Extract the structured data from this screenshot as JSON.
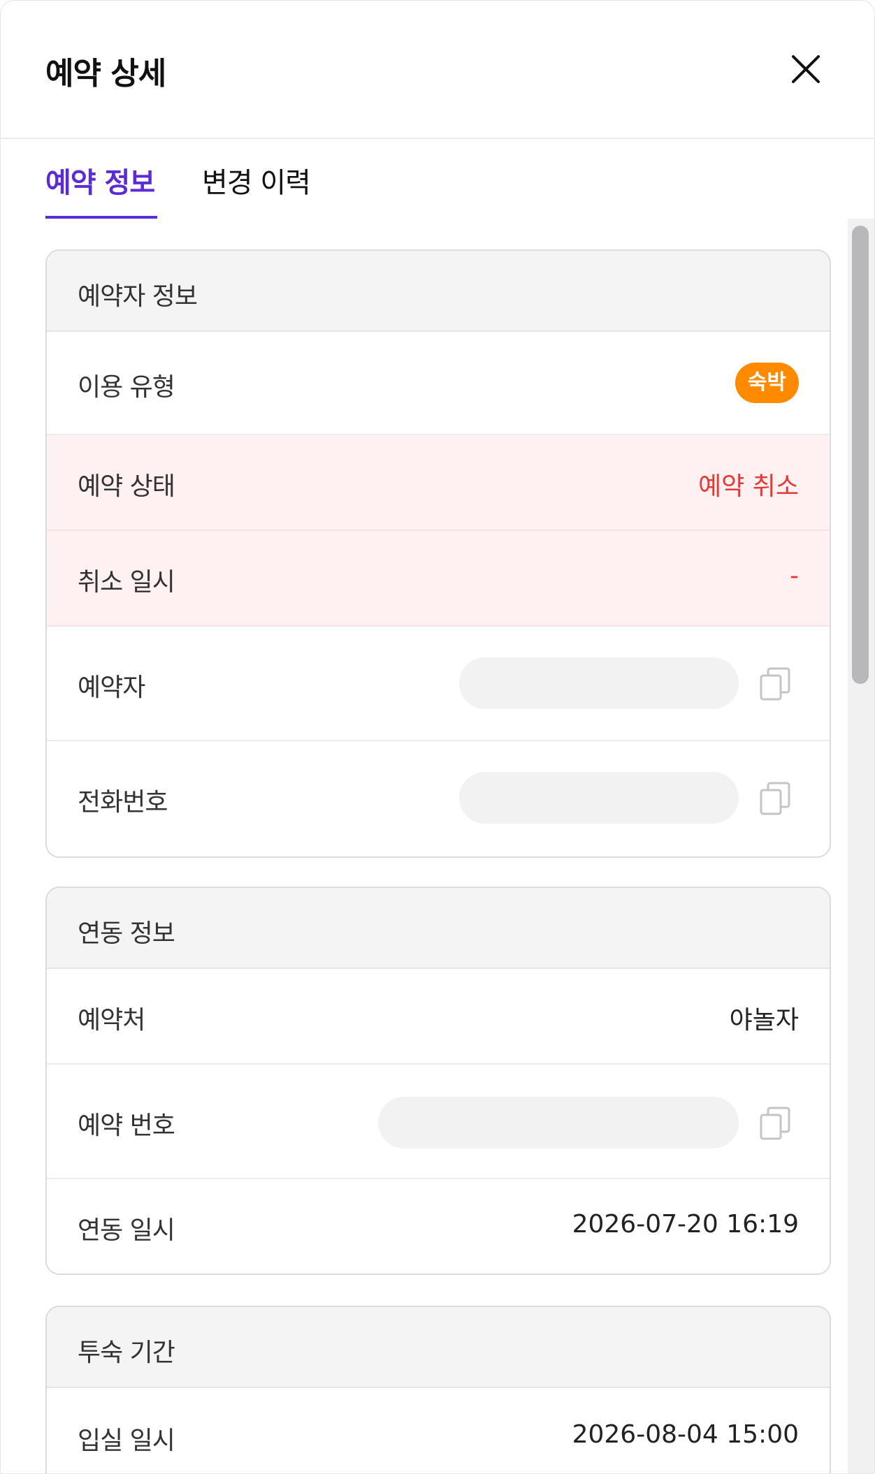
{
  "header": {
    "title": "예약 상세",
    "close_icon": "close-icon"
  },
  "tabs": [
    {
      "label": "예약 정보",
      "active": true
    },
    {
      "label": "변경 이력",
      "active": false
    }
  ],
  "colors": {
    "accent": "#5b2bd6",
    "badge": "#ff8a00",
    "danger_text": "#e53935",
    "danger_bg": "#fff1f1"
  },
  "reserver_info": {
    "title": "예약자 정보",
    "usage_type": {
      "label": "이용 유형",
      "value": "숙박"
    },
    "status": {
      "label": "예약 상태",
      "value": "예약 취소"
    },
    "cancel_time": {
      "label": "취소 일시",
      "value": "-"
    },
    "reserver": {
      "label": "예약자",
      "copy_icon": "copy-icon"
    },
    "phone": {
      "label": "전화번호",
      "copy_icon": "copy-icon"
    }
  },
  "linkage_info": {
    "title": "연동 정보",
    "channel": {
      "label": "예약처",
      "value": "야놀자"
    },
    "reservation_no": {
      "label": "예약 번호",
      "copy_icon": "copy-icon"
    },
    "linked_at": {
      "label": "연동 일시",
      "value": "2026-07-20 16:19"
    }
  },
  "stay_period": {
    "title": "투숙 기간",
    "check_in": {
      "label": "입실 일시",
      "value": "2026-08-04 15:00"
    }
  }
}
